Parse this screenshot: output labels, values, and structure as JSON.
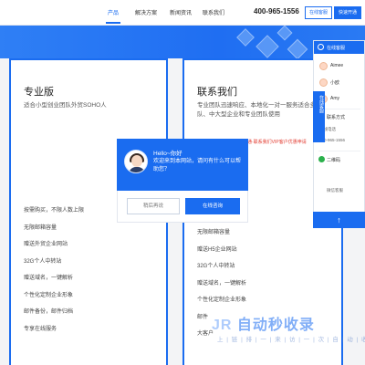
{
  "nav": {
    "items": [
      "产品",
      "解决方案",
      "新闻资讯",
      "联系我们"
    ],
    "phone": "400-965-1556",
    "consult_label": "在线客服",
    "open_label": "快速开通"
  },
  "plans": [
    {
      "title": "专业版",
      "desc": "适合小型创业团队外贸SOHO人",
      "features": [
        "按需购买，不限人数上限",
        "无限邮箱容量",
        "赠送外贸企业网站",
        "32G个人中转站",
        "赠送域名，一键解析",
        "个性化定制企业形象",
        "邮件备份，邮件归档",
        "专享在线服务"
      ]
    },
    {
      "title": "联系我们",
      "desc": "专业团队迅速响应、本地化一对一服务适合多人团队、中大型企业和专业团队使用",
      "features": [
        "无限邮箱容量",
        "赠送H5企业网站",
        "32G个人中转站",
        "赠送域名，一键解析",
        "个性化定制企业形象",
        "邮件",
        "大客户"
      ]
    }
  ],
  "popup": {
    "greeting": "Hello~你好",
    "message": "欢迎来到本网站，请问有什么可以帮助您？",
    "later_label": "稍后再说",
    "online_label": "在线咨询"
  },
  "ticker": "开通·联系我们VIP客户优惠申请",
  "side_panel": {
    "header": "在线客服",
    "agents": [
      "Aimee",
      "小欧",
      "Amy"
    ],
    "contact_label": "联系方式",
    "hotline_label": "热线电话",
    "hotline": "400-965-1556",
    "qr_label": "二维码",
    "wechat_label": "微信客服",
    "top_arrow": "↑"
  },
  "vertical_tab": "在线客服",
  "watermark": {
    "logo": "自动秒收录",
    "tagline": "上 | 链 | 排 | 一 | 来 | 访 | 一 | 次 | 自 | 动 | 收 | 录"
  }
}
